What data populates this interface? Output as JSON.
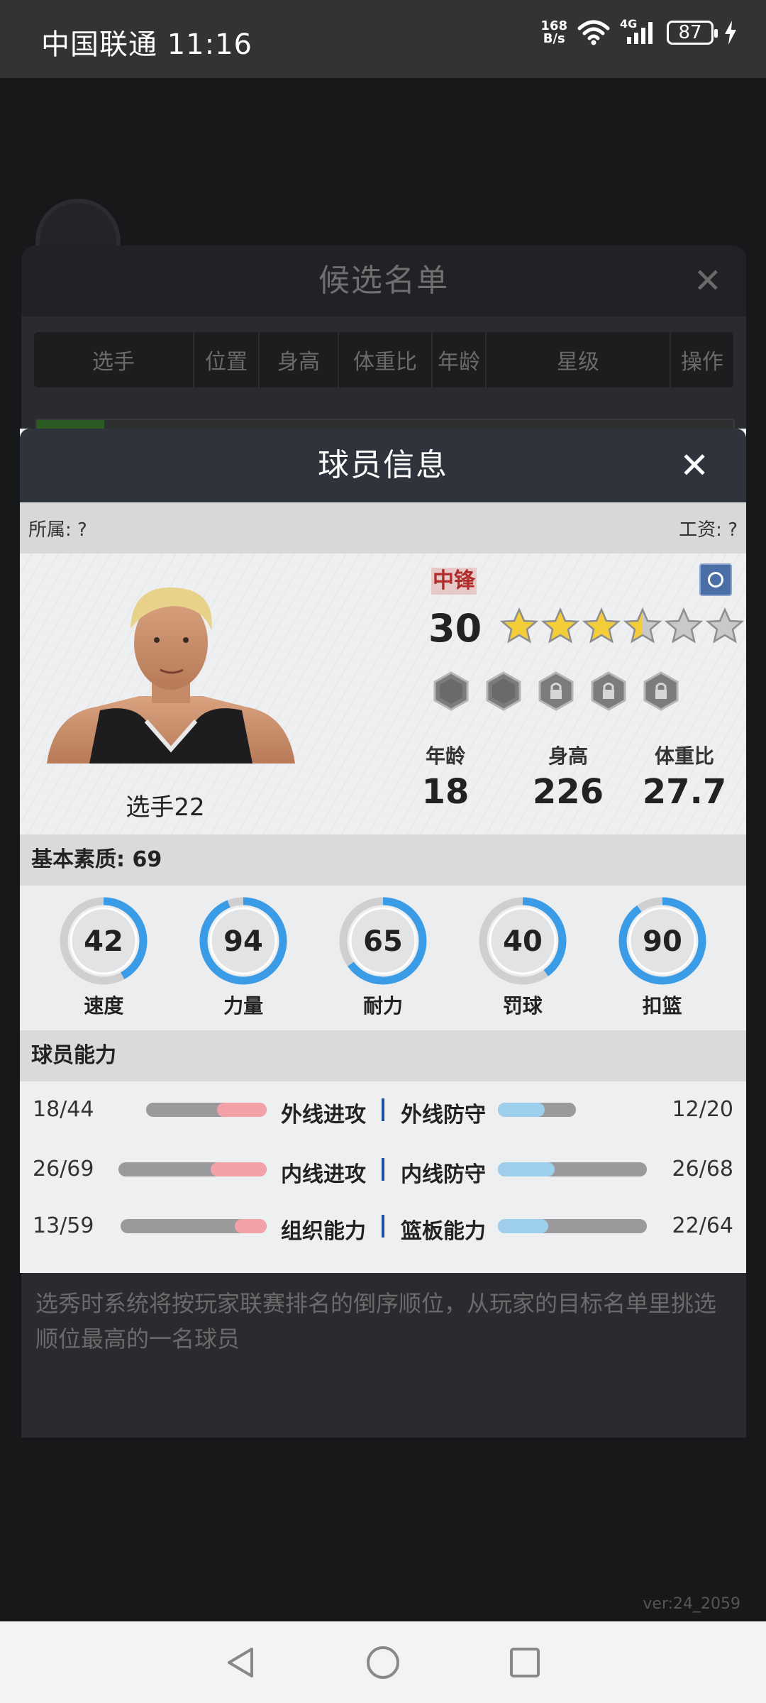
{
  "status_bar": {
    "carrier_time": "中国联通 11:16",
    "speed_value": "168",
    "speed_unit": "B/s",
    "network": "4G",
    "battery": "87"
  },
  "background": {
    "candidate_title": "候选名单",
    "columns": [
      "选手",
      "位置",
      "身高",
      "体重比",
      "年龄",
      "星级",
      "操作"
    ],
    "footnote": "选秀时系统将按玩家联赛排名的倒序顺位，从玩家的目标名单里挑选顺位最高的一名球员",
    "version": "ver:24_2059"
  },
  "modal": {
    "title": "球员信息",
    "affiliation": "所属: ?",
    "salary": "工资: ?",
    "player": {
      "name": "选手22",
      "position": "中锋",
      "overall": "30",
      "stars": 3.5,
      "stars_max": 6,
      "age_label": "年龄",
      "age": "18",
      "height_label": "身高",
      "height": "226",
      "weight_label": "体重比",
      "weight": "27.7"
    },
    "basic_section": "基本素质: 69",
    "gauges": [
      {
        "label": "速度",
        "value": 42
      },
      {
        "label": "力量",
        "value": 94
      },
      {
        "label": "耐力",
        "value": 65
      },
      {
        "label": "罚球",
        "value": 40
      },
      {
        "label": "扣篮",
        "value": 90
      }
    ],
    "ability_section": "球员能力",
    "abilities": [
      {
        "left_value": "18/44",
        "left_name": "外线进攻",
        "right_name": "外线防守",
        "right_value": "12/20",
        "left_frac": 0.41,
        "right_frac": 0.6
      },
      {
        "left_value": "26/69",
        "left_name": "内线进攻",
        "right_name": "内线防守",
        "right_value": "26/68",
        "left_frac": 0.38,
        "right_frac": 0.38
      },
      {
        "left_value": "13/59",
        "left_name": "组织能力",
        "right_name": "篮板能力",
        "right_value": "22/64",
        "left_frac": 0.22,
        "right_frac": 0.34
      }
    ]
  },
  "colors": {
    "ring_blue": "#3a9be6",
    "ring_grey": "#cfcfd1",
    "accent_red": "#b22b2b"
  }
}
